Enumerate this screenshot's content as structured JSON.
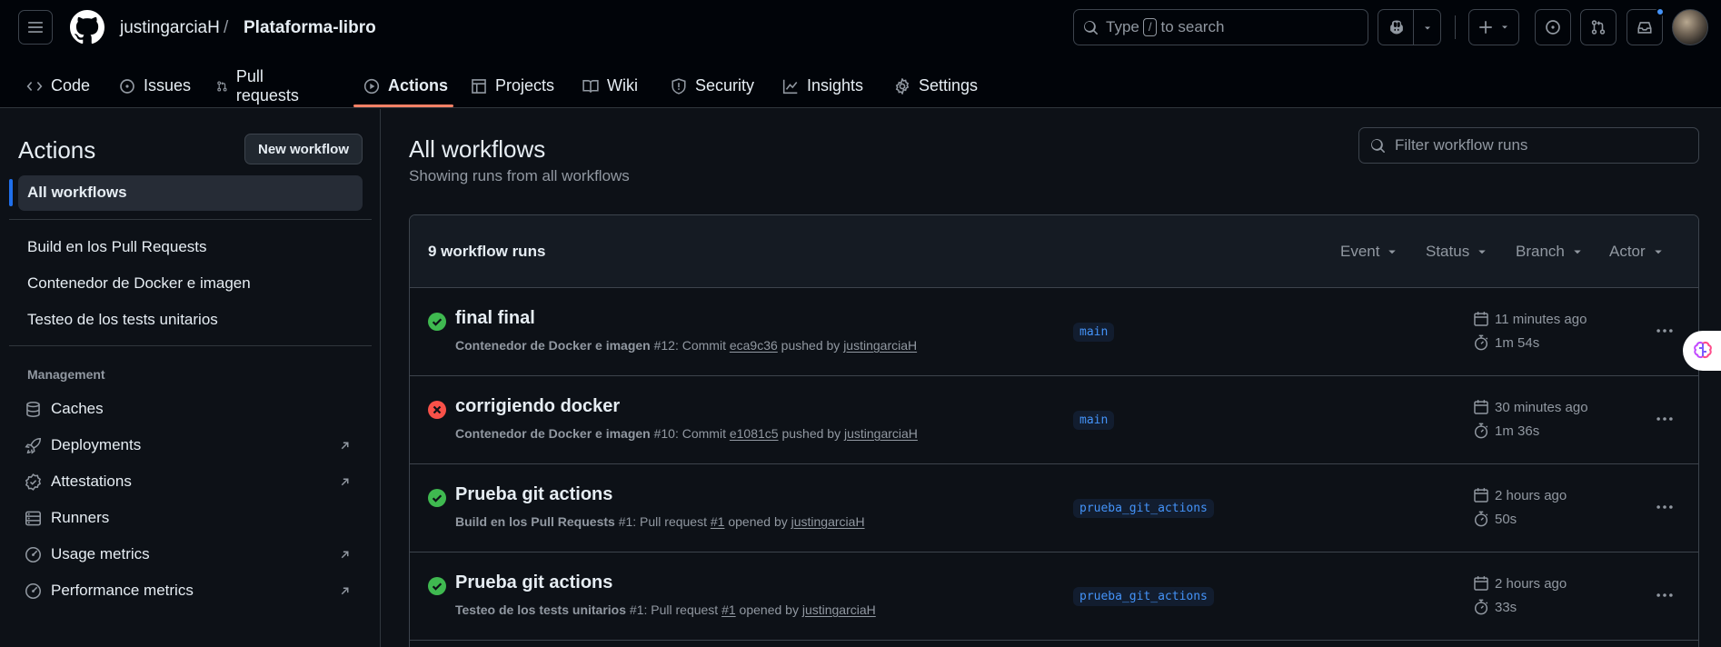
{
  "header": {
    "owner": "justingarciaH",
    "separator": "/",
    "repo": "Plataforma-libro",
    "search_prefix": "Type",
    "search_key": "/",
    "search_suffix": "to search"
  },
  "tabs": [
    {
      "label": "Code",
      "icon": "code-icon"
    },
    {
      "label": "Issues",
      "icon": "issue-icon"
    },
    {
      "label": "Pull requests",
      "icon": "pull-request-icon"
    },
    {
      "label": "Actions",
      "icon": "play-icon",
      "selected": true
    },
    {
      "label": "Projects",
      "icon": "table-icon"
    },
    {
      "label": "Wiki",
      "icon": "book-icon"
    },
    {
      "label": "Security",
      "icon": "shield-icon"
    },
    {
      "label": "Insights",
      "icon": "graph-icon"
    },
    {
      "label": "Settings",
      "icon": "gear-icon"
    }
  ],
  "sidebar": {
    "title": "Actions",
    "new_workflow": "New workflow",
    "all_workflows": "All workflows",
    "workflows": [
      "Build en los Pull Requests",
      "Contenedor de Docker e imagen",
      "Testeo de los tests unitarios"
    ],
    "management_heading": "Management",
    "management": [
      {
        "label": "Caches",
        "icon": "database-icon",
        "external": false
      },
      {
        "label": "Deployments",
        "icon": "rocket-icon",
        "external": true
      },
      {
        "label": "Attestations",
        "icon": "verified-icon",
        "external": true
      },
      {
        "label": "Runners",
        "icon": "server-icon",
        "external": false
      },
      {
        "label": "Usage metrics",
        "icon": "meter-icon",
        "external": true
      },
      {
        "label": "Performance metrics",
        "icon": "meter-icon",
        "external": true
      }
    ]
  },
  "main": {
    "title": "All workflows",
    "subtitle": "Showing runs from all workflows",
    "filter_placeholder": "Filter workflow runs",
    "runs_count": "9 workflow runs",
    "filters": [
      "Event",
      "Status",
      "Branch",
      "Actor"
    ],
    "runs": [
      {
        "status": "success",
        "title": "final final",
        "workflow": "Contenedor de Docker e imagen",
        "meta_mid": " #12: Commit ",
        "ref": "eca9c36",
        "verb": " pushed by ",
        "actor": "justingarciaH",
        "branch": "main",
        "time": "11 minutes ago",
        "duration": "1m 54s"
      },
      {
        "status": "failure",
        "title": "corrigiendo docker",
        "workflow": "Contenedor de Docker e imagen",
        "meta_mid": " #10: Commit ",
        "ref": "e1081c5",
        "verb": " pushed by ",
        "actor": "justingarciaH",
        "branch": "main",
        "time": "30 minutes ago",
        "duration": "1m 36s"
      },
      {
        "status": "success",
        "title": "Prueba git actions",
        "workflow": "Build en los Pull Requests",
        "meta_mid": " #1: Pull request ",
        "ref": "#1",
        "verb": " opened by ",
        "actor": "justingarciaH",
        "branch": "prueba_git_actions",
        "time": "2 hours ago",
        "duration": "50s"
      },
      {
        "status": "success",
        "title": "Prueba git actions",
        "workflow": "Testeo de los tests unitarios",
        "meta_mid": " #1: Pull request ",
        "ref": "#1",
        "verb": " opened by ",
        "actor": "justingarciaH",
        "branch": "prueba_git_actions",
        "time": "2 hours ago",
        "duration": "33s"
      }
    ]
  },
  "colors": {
    "success": "#3fb950",
    "failure": "#f85149",
    "accent": "#f78166",
    "link": "#4493f8"
  }
}
